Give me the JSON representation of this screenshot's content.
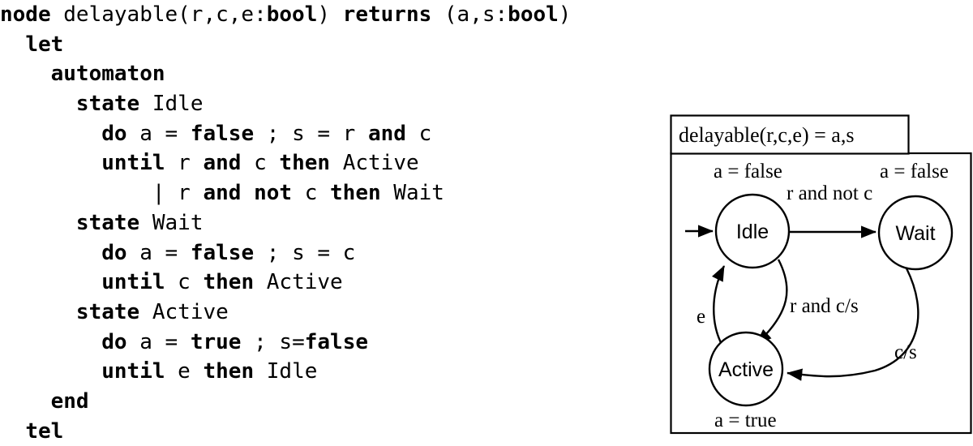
{
  "code": {
    "language": "lustre-scade-automaton",
    "lines": [
      {
        "indent": 0,
        "tokens": [
          {
            "t": "node",
            "b": true
          },
          {
            "t": " delayable(r,c,e:",
            "b": false
          },
          {
            "t": "bool",
            "b": true
          },
          {
            "t": ") ",
            "b": false
          },
          {
            "t": "returns",
            "b": true
          },
          {
            "t": " (a,s:",
            "b": false
          },
          {
            "t": "bool",
            "b": true
          },
          {
            "t": ")",
            "b": false
          }
        ]
      },
      {
        "indent": 2,
        "tokens": [
          {
            "t": "let",
            "b": true
          }
        ]
      },
      {
        "indent": 4,
        "tokens": [
          {
            "t": "automaton",
            "b": true
          }
        ]
      },
      {
        "indent": 6,
        "tokens": [
          {
            "t": "state",
            "b": true
          },
          {
            "t": " Idle",
            "b": false
          }
        ]
      },
      {
        "indent": 8,
        "tokens": [
          {
            "t": "do",
            "b": true
          },
          {
            "t": " a = ",
            "b": false
          },
          {
            "t": "false",
            "b": true
          },
          {
            "t": " ; s = r ",
            "b": false
          },
          {
            "t": "and",
            "b": true
          },
          {
            "t": " c",
            "b": false
          }
        ]
      },
      {
        "indent": 8,
        "tokens": [
          {
            "t": "until",
            "b": true
          },
          {
            "t": " r ",
            "b": false
          },
          {
            "t": "and",
            "b": true
          },
          {
            "t": " c ",
            "b": false
          },
          {
            "t": "then",
            "b": true
          },
          {
            "t": " Active",
            "b": false
          }
        ]
      },
      {
        "indent": 12,
        "tokens": [
          {
            "t": "| r ",
            "b": false
          },
          {
            "t": "and",
            "b": true
          },
          {
            "t": " ",
            "b": false
          },
          {
            "t": "not",
            "b": true
          },
          {
            "t": " c ",
            "b": false
          },
          {
            "t": "then",
            "b": true
          },
          {
            "t": " Wait",
            "b": false
          }
        ]
      },
      {
        "indent": 6,
        "tokens": [
          {
            "t": "state",
            "b": true
          },
          {
            "t": " Wait",
            "b": false
          }
        ]
      },
      {
        "indent": 8,
        "tokens": [
          {
            "t": "do",
            "b": true
          },
          {
            "t": " a = ",
            "b": false
          },
          {
            "t": "false",
            "b": true
          },
          {
            "t": " ; s = c",
            "b": false
          }
        ]
      },
      {
        "indent": 8,
        "tokens": [
          {
            "t": "until",
            "b": true
          },
          {
            "t": " c ",
            "b": false
          },
          {
            "t": "then",
            "b": true
          },
          {
            "t": " Active",
            "b": false
          }
        ]
      },
      {
        "indent": 6,
        "tokens": [
          {
            "t": "state",
            "b": true
          },
          {
            "t": " Active",
            "b": false
          }
        ]
      },
      {
        "indent": 8,
        "tokens": [
          {
            "t": "do",
            "b": true
          },
          {
            "t": " a = ",
            "b": false
          },
          {
            "t": "true",
            "b": true
          },
          {
            "t": " ; s=",
            "b": false
          },
          {
            "t": "false",
            "b": true
          }
        ]
      },
      {
        "indent": 8,
        "tokens": [
          {
            "t": "until",
            "b": true
          },
          {
            "t": " e ",
            "b": false
          },
          {
            "t": "then",
            "b": true
          },
          {
            "t": " Idle",
            "b": false
          }
        ]
      },
      {
        "indent": 4,
        "tokens": [
          {
            "t": "end",
            "b": true
          }
        ]
      },
      {
        "indent": 2,
        "tokens": [
          {
            "t": "tel",
            "b": true
          }
        ]
      }
    ]
  },
  "diagram": {
    "title": "delayable(r,c,e) = a,s",
    "states": [
      {
        "id": "idle",
        "label": "Idle",
        "action": "a = false"
      },
      {
        "id": "wait",
        "label": "Wait",
        "action": "a = false"
      },
      {
        "id": "active",
        "label": "Active",
        "action": "a = true"
      }
    ],
    "transitions": [
      {
        "from": "idle",
        "to": "wait",
        "label": "r and not c"
      },
      {
        "from": "idle",
        "to": "active",
        "label": "r and c/s"
      },
      {
        "from": "active",
        "to": "idle",
        "label": "e"
      },
      {
        "from": "wait",
        "to": "active",
        "label": "c/s"
      }
    ],
    "initial_marker": "incoming-arrow-into-idle",
    "colors": {
      "stroke": "#000000",
      "fill": "#ffffff"
    }
  }
}
